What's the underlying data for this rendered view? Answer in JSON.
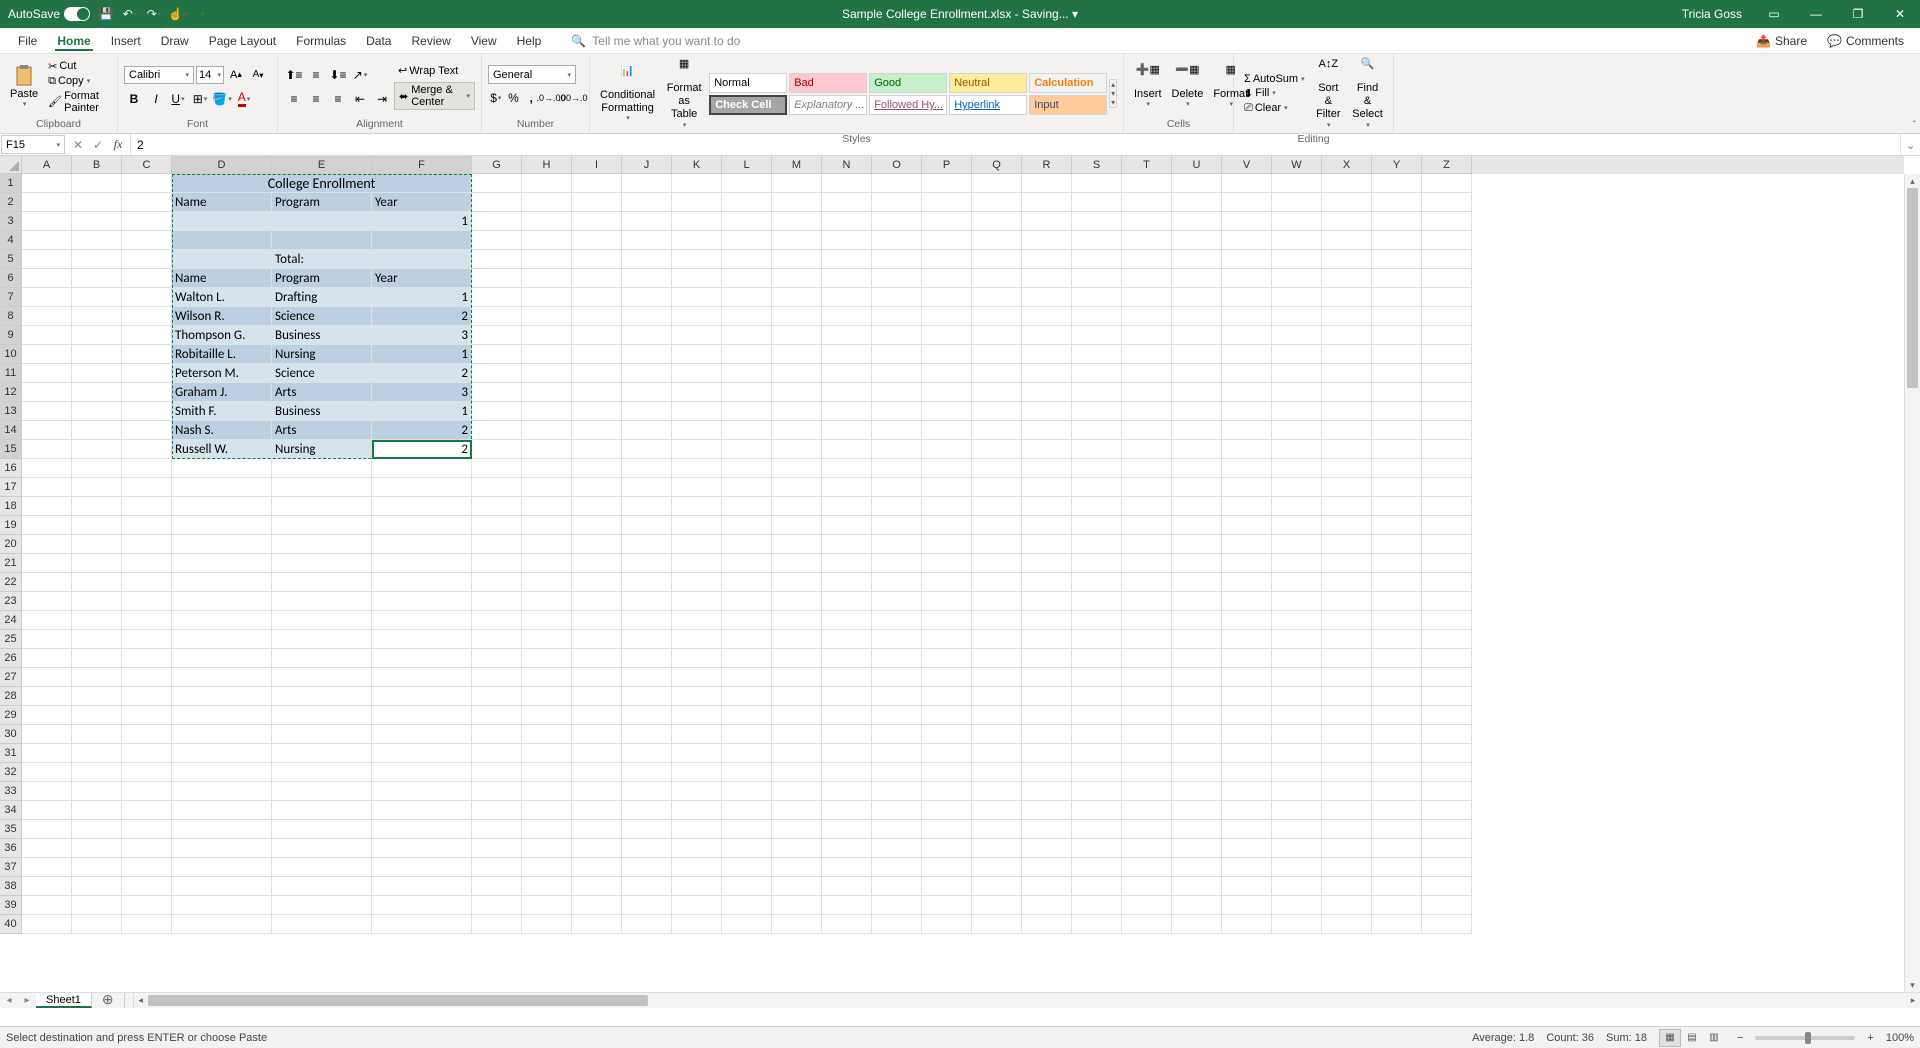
{
  "titlebar": {
    "autosave": "AutoSave",
    "autosave_state": "On",
    "filename": "Sample College Enrollment.xlsx - Saving... ▾",
    "user": "Tricia Goss"
  },
  "tabs": {
    "file": "File",
    "home": "Home",
    "insert": "Insert",
    "draw": "Draw",
    "pagelayout": "Page Layout",
    "formulas": "Formulas",
    "data": "Data",
    "review": "Review",
    "view": "View",
    "help": "Help",
    "tellme": "Tell me what you want to do",
    "share": "Share",
    "comments": "Comments"
  },
  "ribbon": {
    "clipboard": {
      "label": "Clipboard",
      "paste": "Paste",
      "cut": "Cut",
      "copy": "Copy",
      "fmt": "Format Painter"
    },
    "font": {
      "label": "Font",
      "name": "Calibri",
      "size": "14"
    },
    "alignment": {
      "label": "Alignment",
      "wrap": "Wrap Text",
      "merge": "Merge & Center"
    },
    "number": {
      "label": "Number",
      "format": "General"
    },
    "styles": {
      "label": "Styles",
      "cond": "Conditional Formatting",
      "table": "Format as Table",
      "normal": "Normal",
      "bad": "Bad",
      "good": "Good",
      "neutral": "Neutral",
      "calc": "Calculation",
      "check": "Check Cell",
      "explan": "Explanatory ...",
      "followed": "Followed Hy...",
      "hyper": "Hyperlink",
      "input": "Input"
    },
    "cells": {
      "label": "Cells",
      "insert": "Insert",
      "delete": "Delete",
      "format": "Format"
    },
    "editing": {
      "label": "Editing",
      "autosum": "AutoSum",
      "fill": "Fill",
      "clear": "Clear",
      "sort": "Sort & Filter",
      "find": "Find & Select"
    }
  },
  "fbar": {
    "namebox": "F15",
    "formula": "2"
  },
  "columns": [
    "A",
    "B",
    "C",
    "D",
    "E",
    "F",
    "G",
    "H",
    "I",
    "J",
    "K",
    "L",
    "M",
    "N",
    "O",
    "P",
    "Q",
    "R",
    "S",
    "T",
    "U",
    "V",
    "W",
    "X",
    "Y",
    "Z"
  ],
  "chart_data": {
    "type": "table",
    "title": "College Enrollment",
    "header1": {
      "name": "Name",
      "program": "Program",
      "year": "Year"
    },
    "rowA": {
      "year": "1"
    },
    "total_label": "Total:",
    "header2": {
      "name": "Name",
      "program": "Program",
      "year": "Year"
    },
    "rows": [
      {
        "name": "Walton L.",
        "program": "Drafting",
        "year": "1"
      },
      {
        "name": "Wilson R.",
        "program": "Science",
        "year": "2"
      },
      {
        "name": "Thompson G.",
        "program": "Business",
        "year": "3"
      },
      {
        "name": "Robitaille L.",
        "program": "Nursing",
        "year": "1"
      },
      {
        "name": "Peterson M.",
        "program": "Science",
        "year": "2"
      },
      {
        "name": "Graham J.",
        "program": "Arts",
        "year": "3"
      },
      {
        "name": "Smith F.",
        "program": "Business",
        "year": "1"
      },
      {
        "name": "Nash S.",
        "program": "Arts",
        "year": "2"
      },
      {
        "name": "Russell W.",
        "program": "Nursing",
        "year": "2"
      }
    ]
  },
  "status": {
    "msg": "Select destination and press ENTER or choose Paste",
    "avg": "Average: 1.8",
    "count": "Count: 36",
    "sum": "Sum: 18",
    "zoom": "100%"
  },
  "sheet_tab": "Sheet1"
}
